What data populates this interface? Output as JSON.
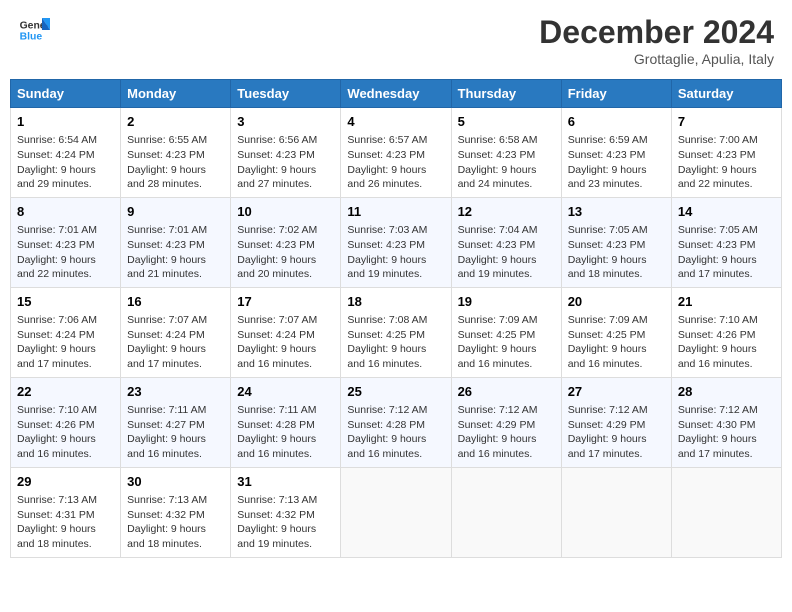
{
  "header": {
    "logo_line1": "General",
    "logo_line2": "Blue",
    "month_title": "December 2024",
    "location": "Grottaglie, Apulia, Italy"
  },
  "days_of_week": [
    "Sunday",
    "Monday",
    "Tuesday",
    "Wednesday",
    "Thursday",
    "Friday",
    "Saturday"
  ],
  "weeks": [
    [
      {
        "day": 1,
        "info": "Sunrise: 6:54 AM\nSunset: 4:24 PM\nDaylight: 9 hours\nand 29 minutes."
      },
      {
        "day": 2,
        "info": "Sunrise: 6:55 AM\nSunset: 4:23 PM\nDaylight: 9 hours\nand 28 minutes."
      },
      {
        "day": 3,
        "info": "Sunrise: 6:56 AM\nSunset: 4:23 PM\nDaylight: 9 hours\nand 27 minutes."
      },
      {
        "day": 4,
        "info": "Sunrise: 6:57 AM\nSunset: 4:23 PM\nDaylight: 9 hours\nand 26 minutes."
      },
      {
        "day": 5,
        "info": "Sunrise: 6:58 AM\nSunset: 4:23 PM\nDaylight: 9 hours\nand 24 minutes."
      },
      {
        "day": 6,
        "info": "Sunrise: 6:59 AM\nSunset: 4:23 PM\nDaylight: 9 hours\nand 23 minutes."
      },
      {
        "day": 7,
        "info": "Sunrise: 7:00 AM\nSunset: 4:23 PM\nDaylight: 9 hours\nand 22 minutes."
      }
    ],
    [
      {
        "day": 8,
        "info": "Sunrise: 7:01 AM\nSunset: 4:23 PM\nDaylight: 9 hours\nand 22 minutes."
      },
      {
        "day": 9,
        "info": "Sunrise: 7:01 AM\nSunset: 4:23 PM\nDaylight: 9 hours\nand 21 minutes."
      },
      {
        "day": 10,
        "info": "Sunrise: 7:02 AM\nSunset: 4:23 PM\nDaylight: 9 hours\nand 20 minutes."
      },
      {
        "day": 11,
        "info": "Sunrise: 7:03 AM\nSunset: 4:23 PM\nDaylight: 9 hours\nand 19 minutes."
      },
      {
        "day": 12,
        "info": "Sunrise: 7:04 AM\nSunset: 4:23 PM\nDaylight: 9 hours\nand 19 minutes."
      },
      {
        "day": 13,
        "info": "Sunrise: 7:05 AM\nSunset: 4:23 PM\nDaylight: 9 hours\nand 18 minutes."
      },
      {
        "day": 14,
        "info": "Sunrise: 7:05 AM\nSunset: 4:23 PM\nDaylight: 9 hours\nand 17 minutes."
      }
    ],
    [
      {
        "day": 15,
        "info": "Sunrise: 7:06 AM\nSunset: 4:24 PM\nDaylight: 9 hours\nand 17 minutes."
      },
      {
        "day": 16,
        "info": "Sunrise: 7:07 AM\nSunset: 4:24 PM\nDaylight: 9 hours\nand 17 minutes."
      },
      {
        "day": 17,
        "info": "Sunrise: 7:07 AM\nSunset: 4:24 PM\nDaylight: 9 hours\nand 16 minutes."
      },
      {
        "day": 18,
        "info": "Sunrise: 7:08 AM\nSunset: 4:25 PM\nDaylight: 9 hours\nand 16 minutes."
      },
      {
        "day": 19,
        "info": "Sunrise: 7:09 AM\nSunset: 4:25 PM\nDaylight: 9 hours\nand 16 minutes."
      },
      {
        "day": 20,
        "info": "Sunrise: 7:09 AM\nSunset: 4:25 PM\nDaylight: 9 hours\nand 16 minutes."
      },
      {
        "day": 21,
        "info": "Sunrise: 7:10 AM\nSunset: 4:26 PM\nDaylight: 9 hours\nand 16 minutes."
      }
    ],
    [
      {
        "day": 22,
        "info": "Sunrise: 7:10 AM\nSunset: 4:26 PM\nDaylight: 9 hours\nand 16 minutes."
      },
      {
        "day": 23,
        "info": "Sunrise: 7:11 AM\nSunset: 4:27 PM\nDaylight: 9 hours\nand 16 minutes."
      },
      {
        "day": 24,
        "info": "Sunrise: 7:11 AM\nSunset: 4:28 PM\nDaylight: 9 hours\nand 16 minutes."
      },
      {
        "day": 25,
        "info": "Sunrise: 7:12 AM\nSunset: 4:28 PM\nDaylight: 9 hours\nand 16 minutes."
      },
      {
        "day": 26,
        "info": "Sunrise: 7:12 AM\nSunset: 4:29 PM\nDaylight: 9 hours\nand 16 minutes."
      },
      {
        "day": 27,
        "info": "Sunrise: 7:12 AM\nSunset: 4:29 PM\nDaylight: 9 hours\nand 17 minutes."
      },
      {
        "day": 28,
        "info": "Sunrise: 7:12 AM\nSunset: 4:30 PM\nDaylight: 9 hours\nand 17 minutes."
      }
    ],
    [
      {
        "day": 29,
        "info": "Sunrise: 7:13 AM\nSunset: 4:31 PM\nDaylight: 9 hours\nand 18 minutes."
      },
      {
        "day": 30,
        "info": "Sunrise: 7:13 AM\nSunset: 4:32 PM\nDaylight: 9 hours\nand 18 minutes."
      },
      {
        "day": 31,
        "info": "Sunrise: 7:13 AM\nSunset: 4:32 PM\nDaylight: 9 hours\nand 19 minutes."
      },
      null,
      null,
      null,
      null
    ]
  ]
}
